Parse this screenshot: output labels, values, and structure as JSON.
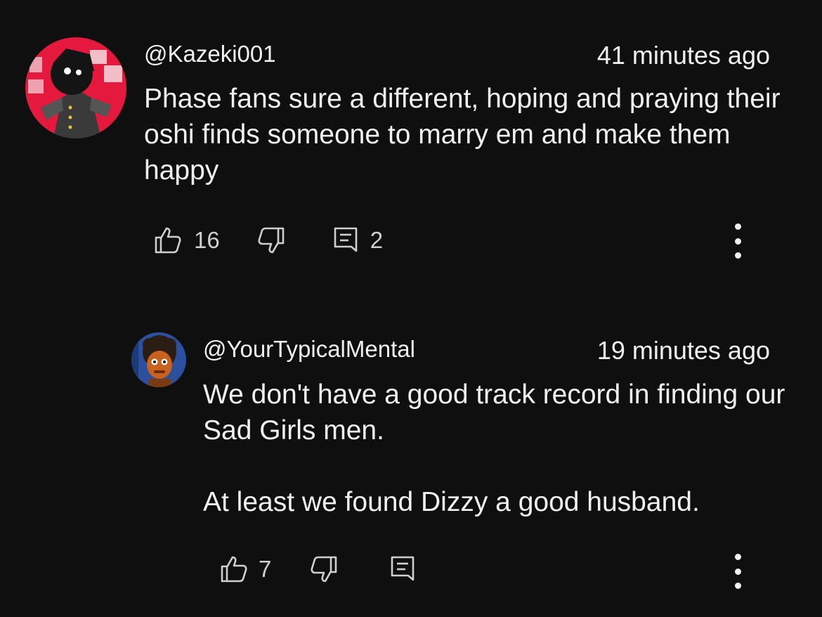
{
  "comments": [
    {
      "handle": "@Kazeki001",
      "time": "41 minutes ago",
      "text": "Phase fans sure a different, hoping and praying their oshi finds someone to marry em and make them happy",
      "likes": "16",
      "replies": "2",
      "avatar_icon": "anime-character-avatar",
      "avatar_color": "#e4193d"
    },
    {
      "handle": "@YourTypicalMental",
      "time": "19 minutes ago",
      "text": "We don't have a good track record in finding our Sad Girls men.\n\nAt least we found Dizzy a good husband.",
      "likes": "7",
      "avatar_icon": "cartoon-character-avatar",
      "avatar_color": "#2c4f9e"
    }
  ]
}
